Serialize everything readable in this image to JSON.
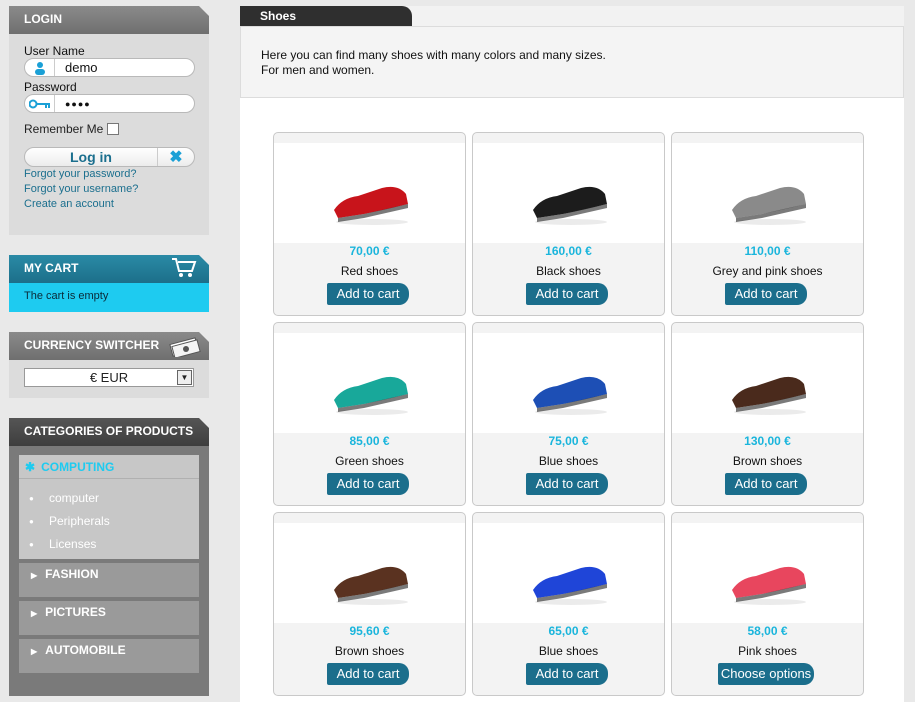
{
  "login": {
    "title": "LOGIN",
    "username_label": "User Name",
    "username_value": "demo",
    "password_label": "Password",
    "password_value": "●●●●",
    "remember_label": "Remember Me",
    "button_label": "Log in",
    "forgot_password": "Forgot your password?",
    "forgot_username": "Forgot your username?",
    "create_account": "Create an account"
  },
  "cart": {
    "title": "MY CART",
    "status": "The cart is empty"
  },
  "currency": {
    "title": "CURRENCY SWITCHER",
    "selected": "€ EUR"
  },
  "categories": {
    "title": "CATEGORIES OF PRODUCTS",
    "active": "COMPUTING",
    "sub_items": [
      "computer",
      "Peripherals",
      "Licenses"
    ],
    "items": [
      "FASHION",
      "PICTURES",
      "AUTOMOBILE"
    ]
  },
  "main": {
    "tab": "Shoes",
    "description_1": "Here you can find many shoes with many colors and many sizes.",
    "description_2": "For men and women."
  },
  "products": [
    {
      "price": "70,00 €",
      "name": "Red shoes",
      "button": "Add to cart",
      "color": "#c8141b"
    },
    {
      "price": "160,00 €",
      "name": "Black shoes",
      "button": "Add to cart",
      "color": "#1c1c1c"
    },
    {
      "price": "110,00 €",
      "name": "Grey and pink shoes",
      "button": "Add to cart",
      "color": "#8a8a8a"
    },
    {
      "price": "85,00 €",
      "name": "Green shoes",
      "button": "Add to cart",
      "color": "#18a89a"
    },
    {
      "price": "75,00 €",
      "name": "Blue shoes",
      "button": "Add to cart",
      "color": "#1d4fb5"
    },
    {
      "price": "130,00 €",
      "name": "Brown shoes",
      "button": "Add to cart",
      "color": "#4a2a1c"
    },
    {
      "price": "95,60 €",
      "name": "Brown shoes",
      "button": "Add to cart",
      "color": "#5a3220"
    },
    {
      "price": "65,00 €",
      "name": "Blue shoes",
      "button": "Add to cart",
      "color": "#1f45d8"
    },
    {
      "price": "58,00 €",
      "name": "Pink shoes",
      "button": "Choose options",
      "color": "#e8465e"
    }
  ]
}
